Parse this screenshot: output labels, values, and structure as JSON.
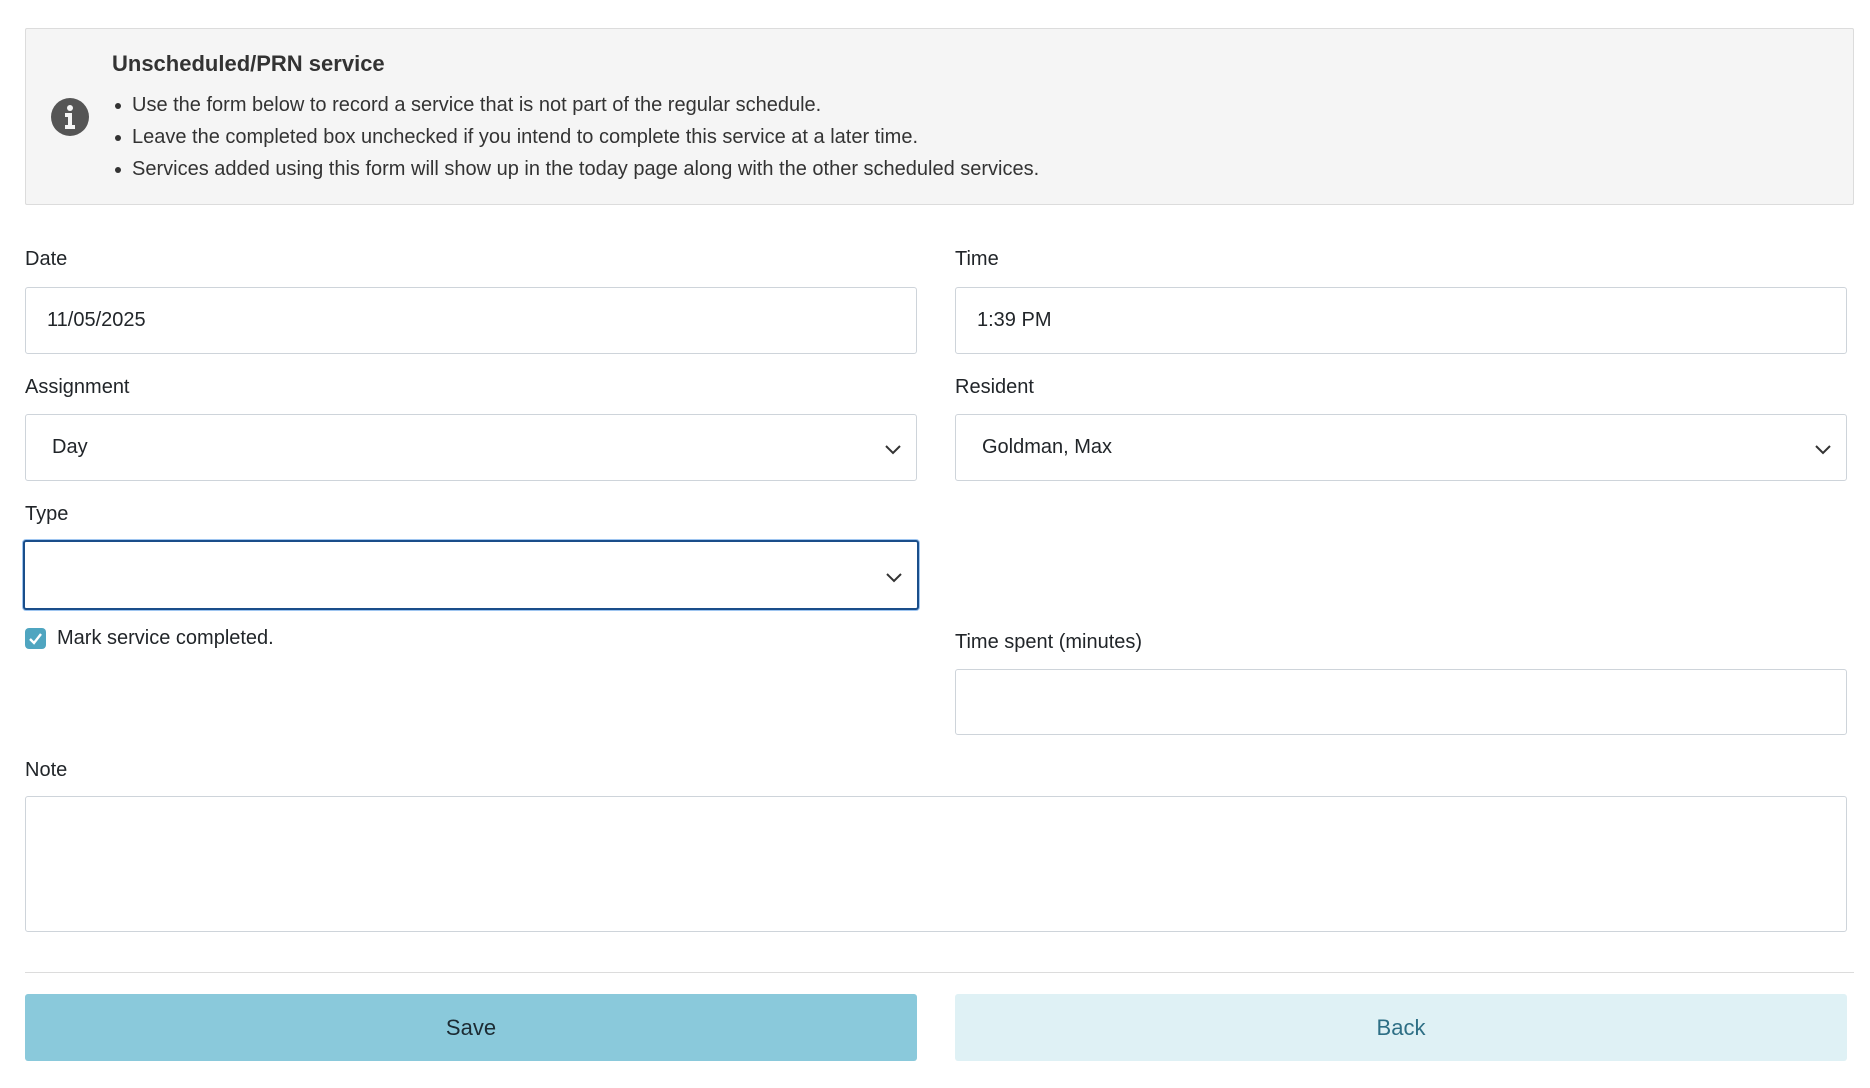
{
  "info": {
    "title": "Unscheduled/PRN service",
    "bullets": [
      "Use the form below to record a service that is not part of the regular schedule.",
      "Leave the completed box unchecked if you intend to complete this service at a later time.",
      "Services added using this form will show up in the today page along with the other scheduled services."
    ],
    "icon": "info-circle-icon"
  },
  "form": {
    "date_label": "Date",
    "date_value": "11/05/2025",
    "time_label": "Time",
    "time_value": "1:39 PM",
    "assignment_label": "Assignment",
    "assignment_value": "Day",
    "resident_label": "Resident",
    "resident_value": "Goldman, Max",
    "type_label": "Type",
    "type_value": "",
    "completed_label": "Mark service completed.",
    "completed_checked": true,
    "time_spent_label": "Time spent (minutes)",
    "time_spent_value": "",
    "note_label": "Note",
    "note_value": ""
  },
  "actions": {
    "save_label": "Save",
    "back_label": "Back"
  },
  "colors": {
    "save_bg": "#8ac9db",
    "back_bg": "#dff1f5",
    "checkbox": "#4fa5c0",
    "focus_border": "#1a4e8a"
  }
}
